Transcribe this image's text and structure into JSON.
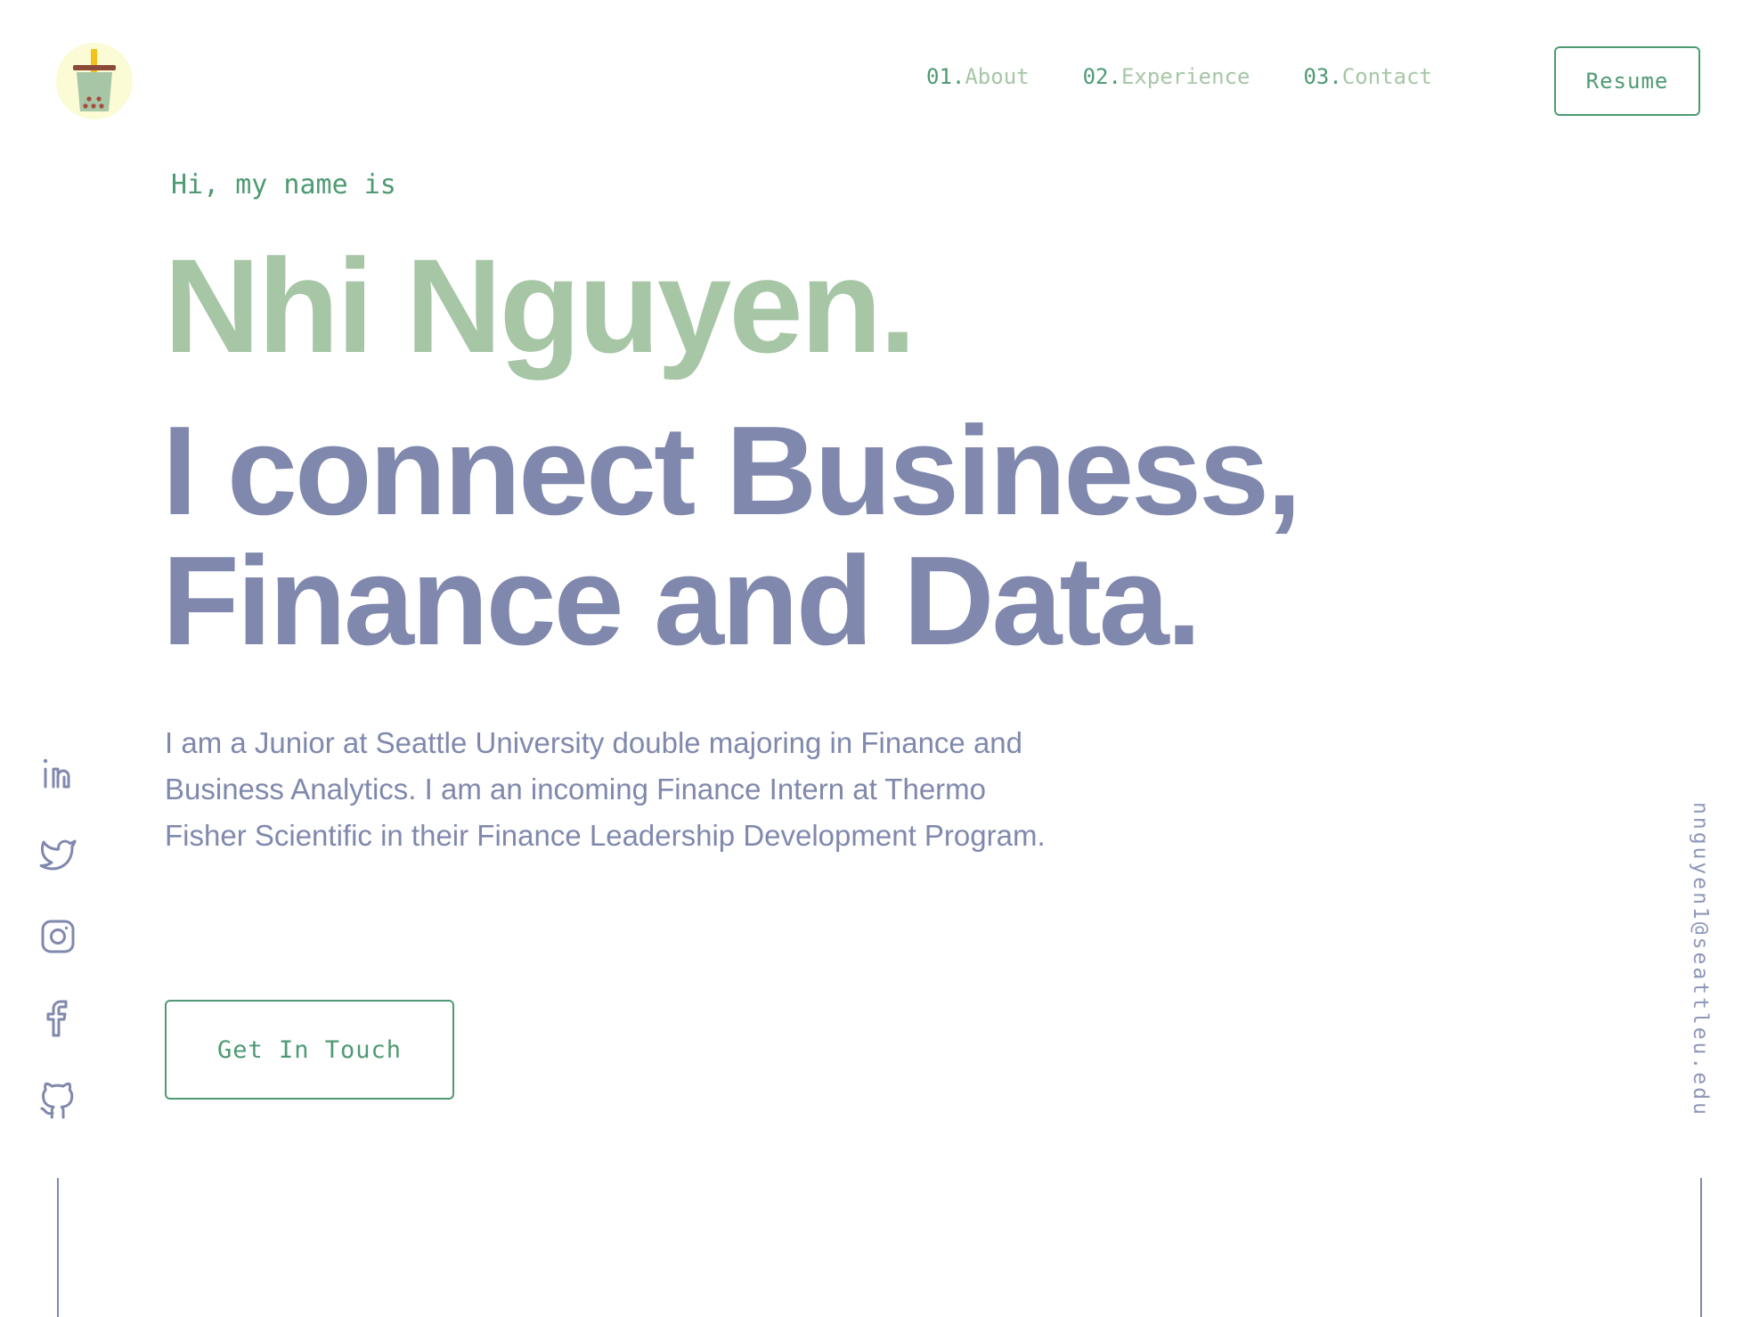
{
  "header": {
    "nav": [
      {
        "num": "01.",
        "label": "About"
      },
      {
        "num": "02.",
        "label": "Experience"
      },
      {
        "num": "03.",
        "label": "Contact"
      }
    ],
    "resume_label": "Resume"
  },
  "hero": {
    "greeting": "Hi, my name is",
    "name": "Nhi Nguyen.",
    "headline_line1": "I connect Business,",
    "headline_line2": "Finance and Data.",
    "bio": "I am a Junior at Seattle University double majoring in Finance and Business Analytics. I am an incoming Finance Intern at Thermo Fisher Scientific in their Finance Leadership Development Program.",
    "cta_label": "Get In Touch"
  },
  "social": {
    "icons": [
      "linkedin-icon",
      "twitter-icon",
      "instagram-icon",
      "facebook-icon",
      "github-icon"
    ]
  },
  "email": "nnguyen1@seattleu.edu",
  "colors": {
    "accent_green": "#4e9a73",
    "name_green": "#a6c6a6",
    "slate": "#8089ad",
    "logo_bg": "#fbfbd5"
  }
}
